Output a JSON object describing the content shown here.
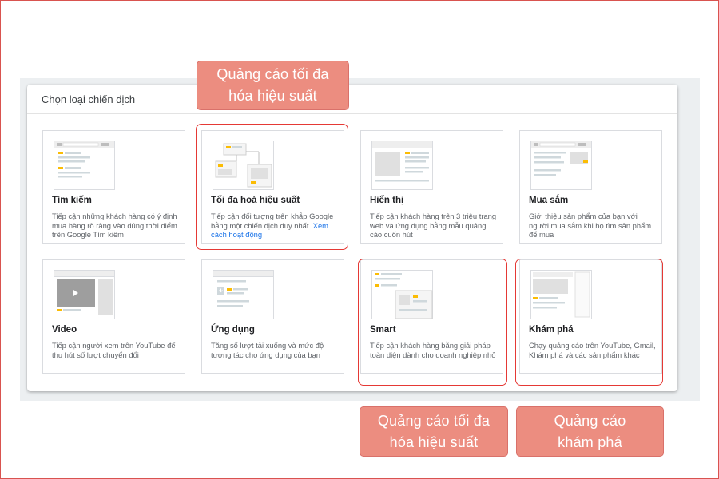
{
  "dialog": {
    "title": "Chọn loại chiến dịch"
  },
  "cards": [
    {
      "title": "Tìm kiếm",
      "desc": "Tiếp cận những khách hàng có ý định mua hàng rõ ràng vào đúng thời điểm trên Google Tìm kiếm",
      "icon": "search-campaign-illustration"
    },
    {
      "title": "Tối đa hoá hiệu suất",
      "desc": "Tiếp cận đối tượng trên khắp Google bằng một chiến dịch duy nhất.",
      "link": "Xem cách hoạt động",
      "icon": "performance-max-illustration"
    },
    {
      "title": "Hiển thị",
      "desc": "Tiếp cận khách hàng trên 3 triệu trang web và ứng dụng bằng mẫu quảng cáo cuốn hút",
      "icon": "display-campaign-illustration"
    },
    {
      "title": "Mua sắm",
      "desc": "Giới thiệu sản phẩm của bạn với người mua sắm khi họ tìm sản phẩm để mua",
      "icon": "shopping-campaign-illustration"
    },
    {
      "title": "Video",
      "desc": "Tiếp cận người xem trên YouTube để thu hút số lượt chuyển đổi",
      "icon": "video-campaign-illustration"
    },
    {
      "title": "Ứng dụng",
      "desc": "Tăng số lượt tải xuống và mức độ tương tác cho ứng dụng của bạn",
      "icon": "app-campaign-illustration"
    },
    {
      "title": "Smart",
      "desc": "Tiếp cận khách hàng bằng giải pháp toàn diện dành cho doanh nghiệp nhỏ",
      "icon": "smart-campaign-illustration"
    },
    {
      "title": "Khám phá",
      "desc": "Chạy quảng cáo trên YouTube, Gmail, Khám phá và các sản phẩm khác",
      "icon": "discovery-campaign-illustration"
    }
  ],
  "callouts": {
    "top": "Quảng cáo tối đa\nhóa hiệu suất",
    "bottom_left": "Quảng cáo tối đa\nhóa hiệu suất",
    "bottom_right": "Quảng cáo\nkhám phá"
  },
  "colors": {
    "accent": "#fbbc04",
    "highlight_border": "#e53935",
    "callout_bg": "#ec8d80",
    "link": "#1a73e8"
  }
}
